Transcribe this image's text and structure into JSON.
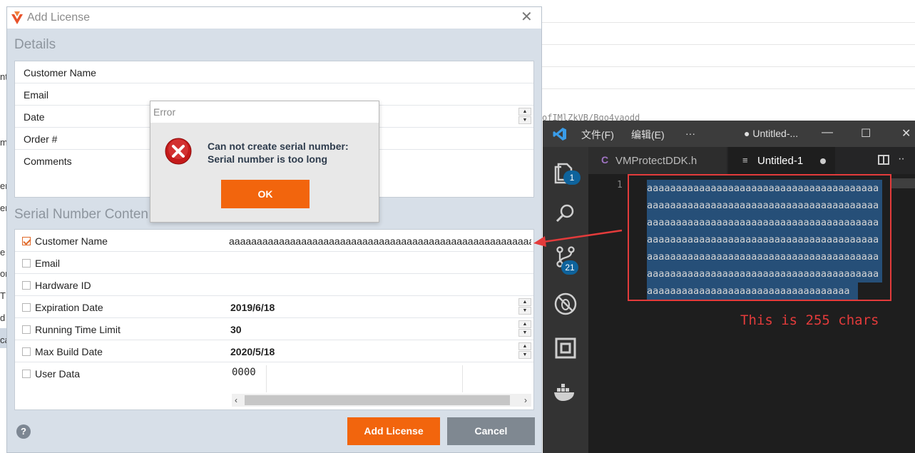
{
  "add_license": {
    "title": "Add License",
    "details_title": "Details",
    "details_fields": [
      {
        "label": "Customer Name"
      },
      {
        "label": "Email"
      },
      {
        "label": "Date"
      },
      {
        "label": "Order #"
      },
      {
        "label": "Comments"
      }
    ],
    "serial_title": "Serial Number Conten",
    "serial_fields": [
      {
        "label": "Customer Name",
        "checked": true,
        "value": "aaaaaaaaaaaaaaaaaaaaaaaaaaaaaaaaaaaaaaaaaaaaaaaaaaaaaaaaaaaaaaaa"
      },
      {
        "label": "Email",
        "checked": false,
        "value": ""
      },
      {
        "label": "Hardware ID",
        "checked": false,
        "value": ""
      },
      {
        "label": "Expiration Date",
        "checked": false,
        "value": "2019/6/18"
      },
      {
        "label": "Running Time Limit",
        "checked": false,
        "value": "30"
      },
      {
        "label": "Max Build Date",
        "checked": false,
        "value": "2020/5/18"
      },
      {
        "label": "User Data",
        "checked": false,
        "value": "0000"
      }
    ],
    "help_label": "?",
    "add_button": "Add License",
    "cancel_button": "Cancel",
    "close_glyph": "✕"
  },
  "error_dialog": {
    "title": "Error",
    "message_line1": "Can not create serial number:",
    "message_line2": "Serial number is too long",
    "ok_button": "OK"
  },
  "vscode": {
    "menu": [
      "文件(F)",
      "编辑(E)",
      "···"
    ],
    "window_title": "● Untitled-...",
    "tabs": [
      {
        "icon": "C",
        "label": "VMProtectDDK.h"
      },
      {
        "icon": "≡",
        "label": "Untitled-1"
      }
    ],
    "explorer_badge": "1",
    "scm_badge": "21",
    "line_number": "1",
    "code_lines": [
      "aaaaaaaaaaaaaaaaaaaaaaaaaaaaaaaaaaaaaaaa",
      "aaaaaaaaaaaaaaaaaaaaaaaaaaaaaaaaaaaaaaaa",
      "aaaaaaaaaaaaaaaaaaaaaaaaaaaaaaaaaaaaaaaa",
      "aaaaaaaaaaaaaaaaaaaaaaaaaaaaaaaaaaaaaaaa",
      "aaaaaaaaaaaaaaaaaaaaaaaaaaaaaaaaaaaaaaaa",
      "aaaaaaaaaaaaaaaaaaaaaaaaaaaaaaaaaaaaaaaa",
      "aaaaaaaaaaaaaaaaaaaaaaaaaaaaaaaaaaa"
    ],
    "annotation": "This is 255 chars"
  },
  "background": {
    "code_fragment": "ofIMlZkVB/Bgo4yaodd",
    "left_fragments": [
      "nt",
      "m",
      "er",
      "er",
      "e",
      "on",
      "T",
      "d",
      "ca"
    ]
  },
  "colors": {
    "accent_orange": "#f2650d",
    "cancel_gray": "#7f8891",
    "annotation_red": "#e33b3b",
    "selection_blue": "#264f78"
  }
}
